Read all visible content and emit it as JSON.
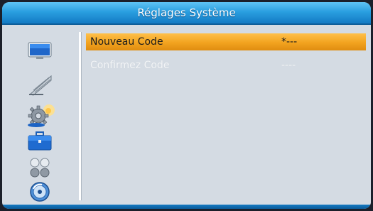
{
  "window": {
    "title": "Réglages Système"
  },
  "sidebar": {
    "icons": [
      {
        "name": "tv-icon"
      },
      {
        "name": "satellite-dish-icon"
      },
      {
        "name": "gear-settings-icon"
      },
      {
        "name": "briefcase-icon"
      },
      {
        "name": "dots-icon"
      },
      {
        "name": "disc-icon"
      }
    ],
    "selected_icon": "gear-settings-icon"
  },
  "menu": {
    "rows": [
      {
        "label": "Nouveau Code",
        "value": "*---",
        "state": "selected"
      },
      {
        "label": "Confirmez Code",
        "value": "----",
        "state": "disabled"
      }
    ]
  },
  "colors": {
    "title_bar": "#2a9fe0",
    "highlight": "#f2a31f",
    "panel_bg": "#d4dbe3"
  }
}
